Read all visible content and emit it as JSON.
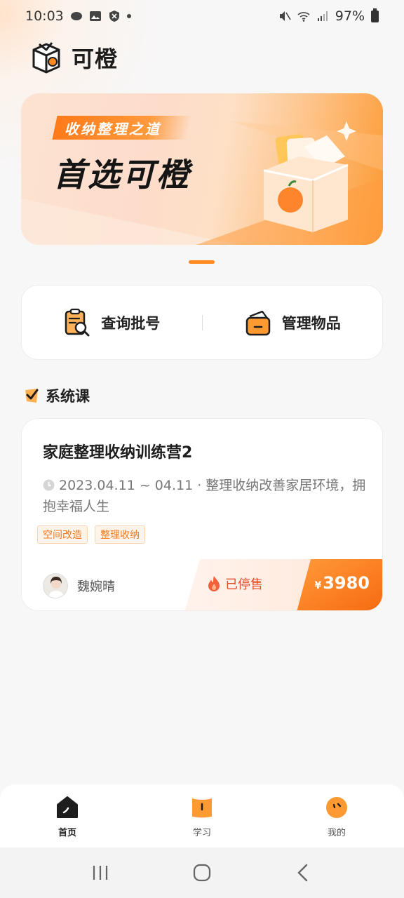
{
  "status_bar": {
    "time": "10:03",
    "battery": "97%"
  },
  "header": {
    "app_name": "可橙"
  },
  "banner": {
    "tag": "收纳整理之道",
    "headline": "首选可橙"
  },
  "quick_actions": [
    {
      "label": "查询批号",
      "icon": "search-document-icon"
    },
    {
      "label": "管理物品",
      "icon": "box-icon"
    }
  ],
  "section": {
    "title": "系统课"
  },
  "course": {
    "title": "家庭整理收纳训练营2",
    "description": "2023.04.11 ~ 04.11 · 整理收纳改善家居环境，拥抱幸福人生",
    "tags": [
      "空间改造",
      "整理收纳"
    ],
    "teacher": "魏婉晴",
    "status": "已停售",
    "currency": "¥",
    "price": "3980"
  },
  "tabbar": [
    {
      "label": "首页",
      "icon": "home-icon",
      "active": true
    },
    {
      "label": "学习",
      "icon": "book-icon",
      "active": false
    },
    {
      "label": "我的",
      "icon": "profile-face-icon",
      "active": false
    }
  ],
  "colors": {
    "accent": "#ff8a1f",
    "status_red": "#e2502a",
    "price_orange": "#fb7a14"
  }
}
